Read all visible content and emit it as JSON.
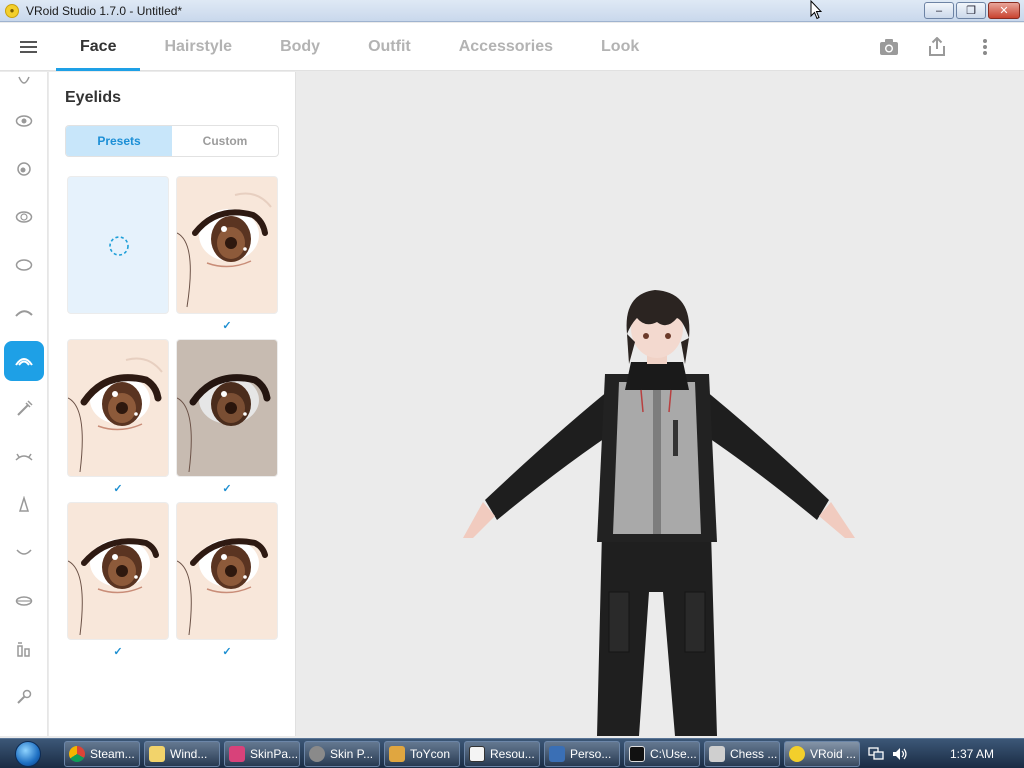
{
  "window": {
    "title": "VRoid Studio 1.7.0 - Untitled*",
    "minimize": "–",
    "restore": "❐",
    "close": "✕"
  },
  "header": {
    "tabs": [
      {
        "label": "Face",
        "active": true
      },
      {
        "label": "Hairstyle",
        "active": false
      },
      {
        "label": "Body",
        "active": false
      },
      {
        "label": "Outfit",
        "active": false
      },
      {
        "label": "Accessories",
        "active": false
      },
      {
        "label": "Look",
        "active": false
      }
    ],
    "actions": [
      "camera-icon",
      "export-icon",
      "more-vert-icon"
    ]
  },
  "rail": {
    "items": [
      {
        "icon": "face-overview-icon"
      },
      {
        "icon": "eye-icon"
      },
      {
        "icon": "iris-icon"
      },
      {
        "icon": "eye-whites-icon"
      },
      {
        "icon": "face-shape-icon"
      },
      {
        "icon": "eyebrow-icon"
      },
      {
        "icon": "eyelid-icon",
        "active": true
      },
      {
        "icon": "eyelash-icon"
      },
      {
        "icon": "eyeline-icon"
      },
      {
        "icon": "nose-icon"
      },
      {
        "icon": "mouth-icon"
      },
      {
        "icon": "lips-icon"
      },
      {
        "icon": "teeth-icon"
      },
      {
        "icon": "ear-icon"
      }
    ]
  },
  "panel": {
    "title": "Eyelids",
    "segments": [
      {
        "label": "Presets",
        "active": true
      },
      {
        "label": "Custom",
        "active": false
      }
    ],
    "check_mark": "✓",
    "presets": [
      {
        "kind": "none",
        "checked": false
      },
      {
        "kind": "skin",
        "checked": true
      },
      {
        "kind": "skin",
        "checked": true
      },
      {
        "kind": "dark",
        "checked": true
      },
      {
        "kind": "skin",
        "checked": true
      },
      {
        "kind": "skin",
        "checked": true
      }
    ]
  },
  "taskbar": {
    "tasks": [
      {
        "label": "Steam...",
        "color": "#e9e9e9"
      },
      {
        "label": "Wind...",
        "color": "#f2d36b"
      },
      {
        "label": "SkinPa...",
        "color": "#d8427a"
      },
      {
        "label": "Skin P...",
        "color": "#8a8a8a"
      },
      {
        "label": "ToYcon",
        "color": "#e0a640"
      },
      {
        "label": "Resou...",
        "color": "#f4f4f4"
      },
      {
        "label": "Perso...",
        "color": "#3a6fb5"
      },
      {
        "label": "C:\\Use...",
        "color": "#111111"
      },
      {
        "label": "Chess ...",
        "color": "#cfcfcf"
      },
      {
        "label": "VRoid ...",
        "color": "#f3cf2b"
      }
    ],
    "clock": "1:37 AM"
  },
  "colors": {
    "accent": "#1ea0e6",
    "segment_active_bg": "#c8e6fa"
  }
}
